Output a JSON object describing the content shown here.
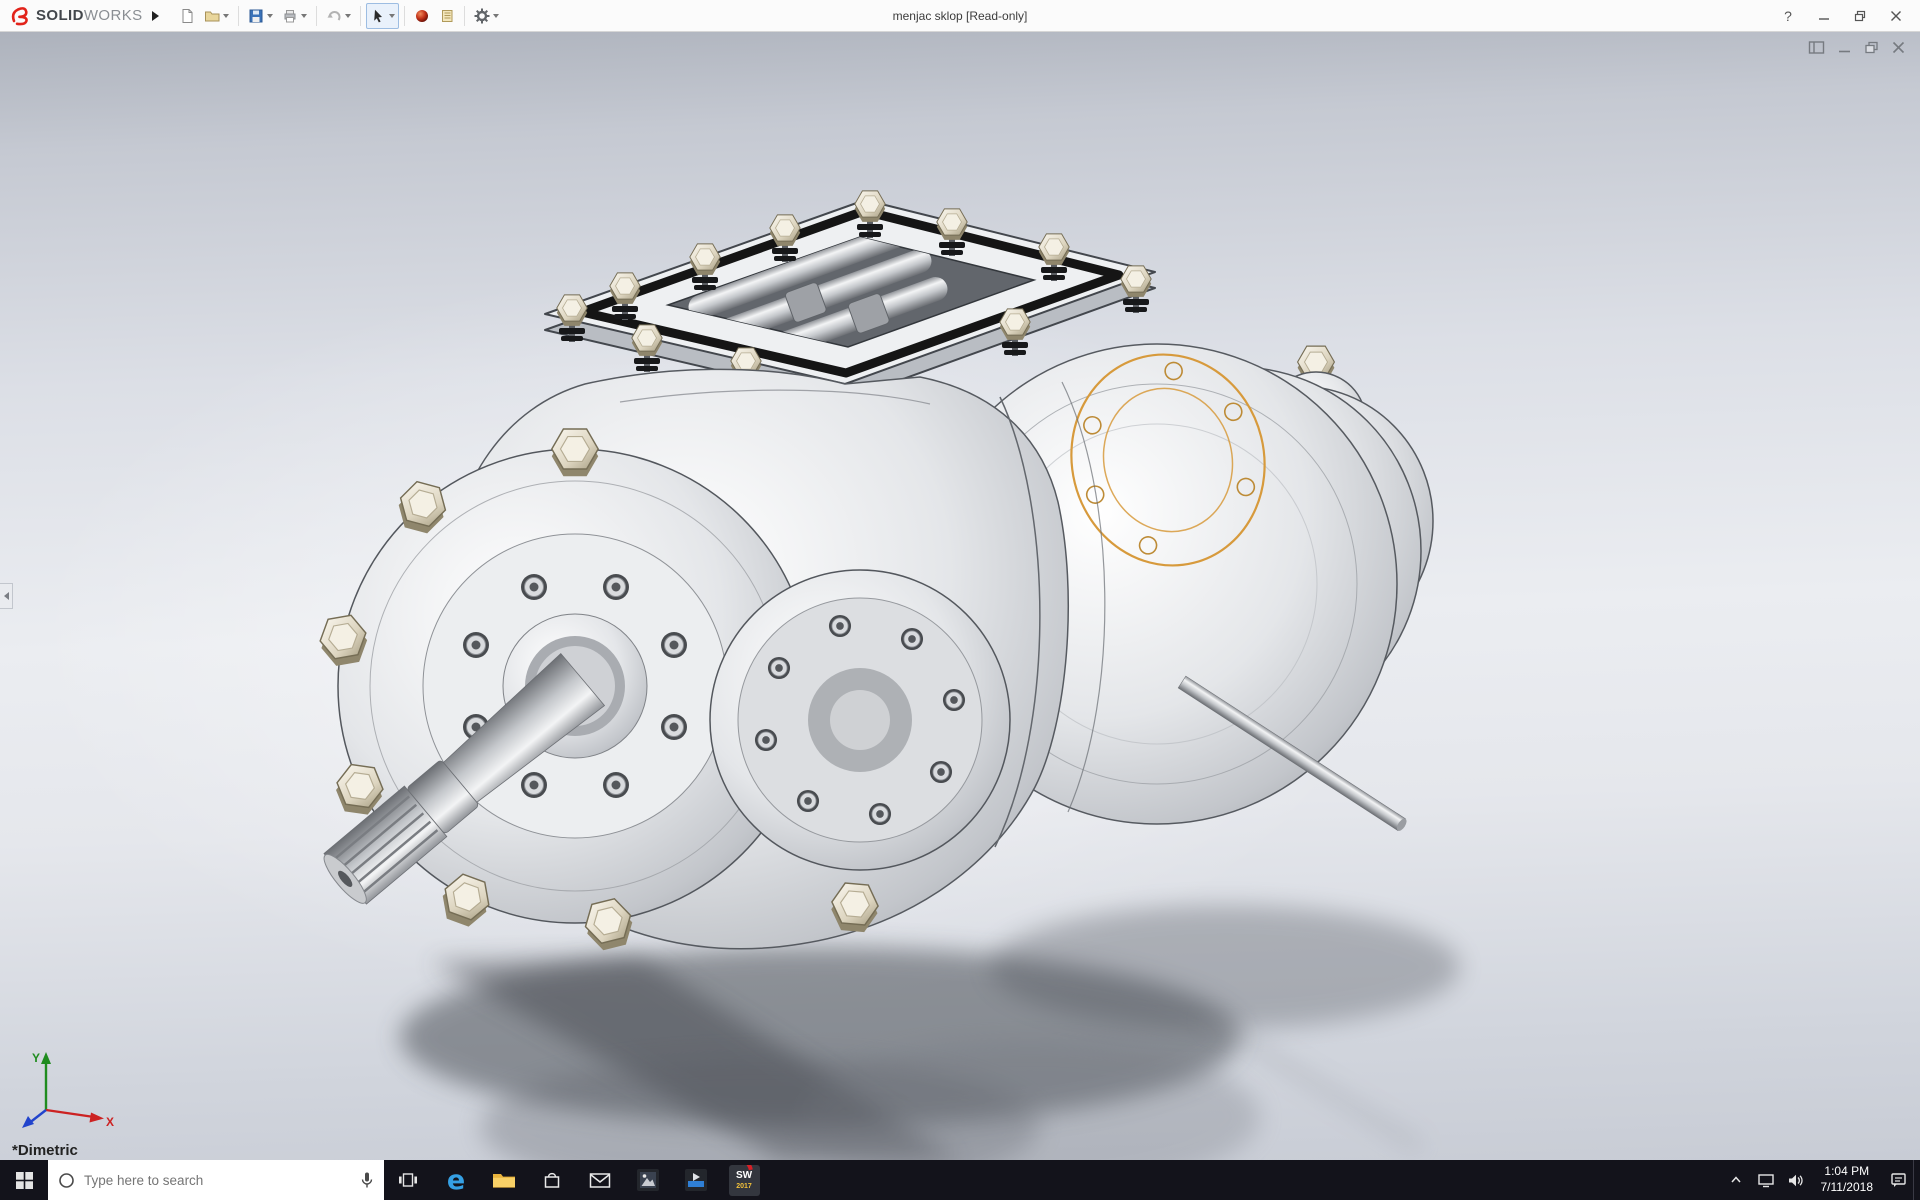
{
  "titlebar": {
    "brand_bold": "SOLID",
    "brand_light": "WORKS",
    "document_title": "menjac sklop [Read-only]",
    "help_glyph": "?",
    "toolbar_icons": [
      "new-document",
      "open",
      "save",
      "print",
      "undo",
      "select-tool",
      "appearances",
      "design-binder",
      "options"
    ]
  },
  "document_window": {
    "control_icons": [
      "dock-panel",
      "minimize",
      "restore",
      "close"
    ]
  },
  "viewport": {
    "view_orientation": "*Dimetric",
    "selection_color": "#d79a3c",
    "model_name": "gearbox-assembly",
    "triad": {
      "x_label": "X",
      "y_label": "Y"
    }
  },
  "taskbar": {
    "search_placeholder": "Type here to search",
    "app_icons": [
      "start",
      "task-view",
      "edge",
      "file-explorer",
      "store",
      "mail",
      "photos",
      "media-player",
      "solidworks"
    ],
    "tray_icons": [
      "hidden-icons-chevron",
      "network",
      "volume",
      "clock",
      "action-center"
    ],
    "edge_glyph": "e",
    "solidworks_badge": {
      "text": "SW",
      "year": "2017"
    },
    "clock": {
      "time": "1:04 PM",
      "date": "7/11/2018"
    }
  }
}
